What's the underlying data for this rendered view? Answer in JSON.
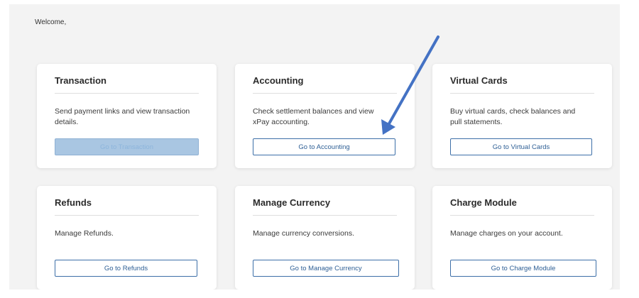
{
  "welcome": "Welcome,",
  "accent_color": "#3d6fa8",
  "cards": [
    {
      "title": "Transaction",
      "description": "Send payment links and view transaction details.",
      "button": "Go to Transaction",
      "button_state": "disabled"
    },
    {
      "title": "Accounting",
      "description": "Check settlement balances and view xPay accounting.",
      "button": "Go to Accounting",
      "button_state": "enabled"
    },
    {
      "title": "Virtual Cards",
      "description": "Buy virtual cards, check balances and pull statements.",
      "button": "Go to Virtual Cards",
      "button_state": "enabled"
    },
    {
      "title": "Refunds",
      "description": "Manage Refunds.",
      "button": "Go to Refunds",
      "button_state": "enabled"
    },
    {
      "title": "Manage Currency",
      "description": "Manage currency conversions.",
      "button": "Go to Manage Currency",
      "button_state": "enabled"
    },
    {
      "title": "Charge Module",
      "description": "Manage charges on your account.",
      "button": "Go to Charge Module",
      "button_state": "enabled"
    }
  ]
}
